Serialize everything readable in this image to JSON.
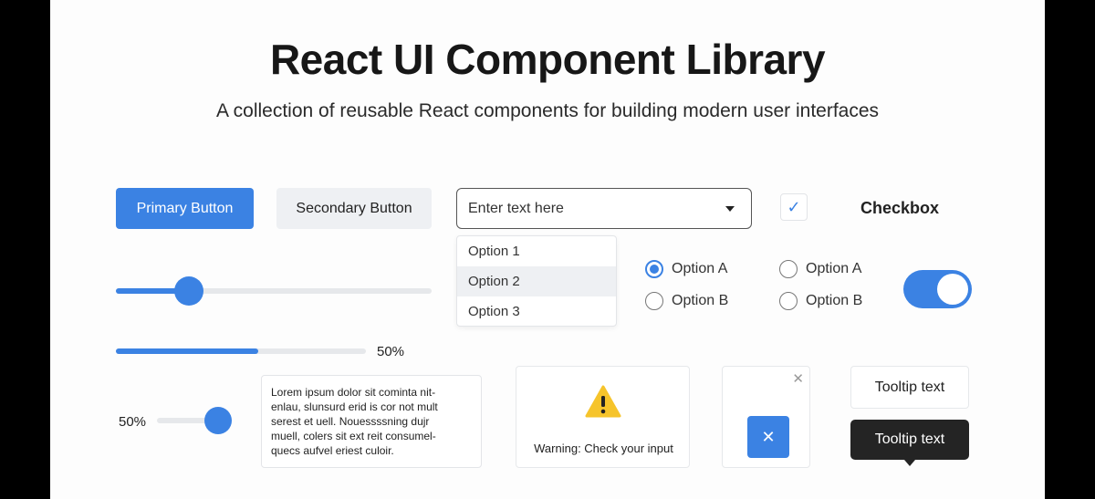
{
  "header": {
    "title": "React UI Component Library",
    "subtitle": "A collection of reusable React components for building modern user interfaces"
  },
  "buttons": {
    "primary_label": "Primary Button",
    "secondary_label": "Secondary Button"
  },
  "select": {
    "placeholder": "Enter text here",
    "options": [
      "Option 1",
      "Option 2",
      "Option 3"
    ],
    "highlighted_option": "Option 2"
  },
  "checkbox": {
    "label": "Checkbox",
    "checked": true
  },
  "radio_group_1": {
    "options": [
      {
        "label": "Option A",
        "selected": true
      },
      {
        "label": "Option B",
        "selected": false
      }
    ]
  },
  "radio_group_2": {
    "options": [
      {
        "label": "Option A",
        "selected": false
      },
      {
        "label": "Option B",
        "selected": false
      }
    ]
  },
  "toggle": {
    "on": true
  },
  "slider_1": {
    "value_fraction": 0.23
  },
  "progress": {
    "value_fraction": 0.57,
    "label": "50%"
  },
  "slider_2": {
    "label": "50%",
    "value_fraction": 0.82
  },
  "textarea": {
    "text": "Lorem ipsum dolor sit cominta nit-\nenlau, slunsurd erid is cor not mult\nserest et uell. Nouessssning dujr\nmuell, colers sit ext reit consumel-\nquecs aufvel eriest culoir."
  },
  "alert": {
    "text": "Warning: Check your input",
    "icon": "warning-triangle-icon"
  },
  "modal": {
    "close_icon": "close-icon",
    "action_icon": "close-icon"
  },
  "tooltips": {
    "light_text": "Tooltip text",
    "dark_text": "Tooltip text"
  },
  "colors": {
    "accent": "#3b82e3",
    "secondary_bg": "#eef0f3",
    "tooltip_dark": "#242424",
    "warning": "#f6c42b"
  }
}
